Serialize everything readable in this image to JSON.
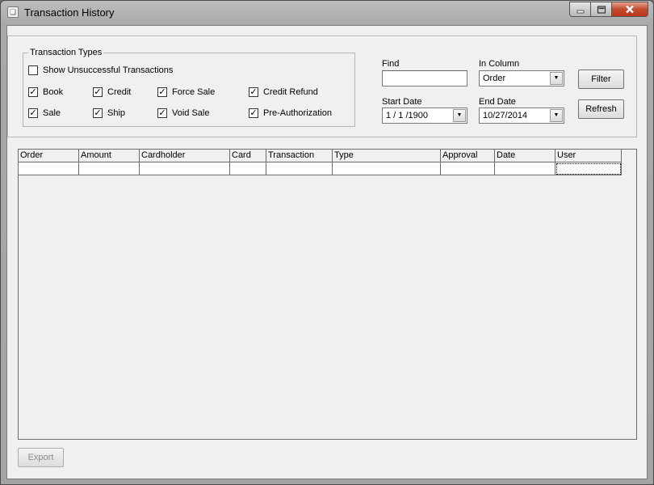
{
  "window": {
    "title": "Transaction History",
    "icon": "app-icon",
    "controls": {
      "minimize": "minimize-icon",
      "maximize": "maximize-icon",
      "close": "close-icon"
    }
  },
  "filters": {
    "group_title": "Transaction Types",
    "show_unsuccessful": {
      "label": "Show Unsuccessful Transactions",
      "checked": false
    },
    "types": [
      {
        "label": "Book",
        "checked": true
      },
      {
        "label": "Credit",
        "checked": true
      },
      {
        "label": "Force Sale",
        "checked": true
      },
      {
        "label": "Credit Refund",
        "checked": true
      },
      {
        "label": "Sale",
        "checked": true
      },
      {
        "label": "Ship",
        "checked": true
      },
      {
        "label": "Void Sale",
        "checked": true
      },
      {
        "label": "Pre-Authorization",
        "checked": true
      }
    ],
    "find": {
      "label": "Find",
      "value": ""
    },
    "in_column": {
      "label": "In Column",
      "value": "Order"
    },
    "start_date": {
      "label": "Start Date",
      "value": "1 / 1 /1900"
    },
    "end_date": {
      "label": "End Date",
      "value": "10/27/2014"
    },
    "filter_button": "Filter",
    "refresh_button": "Refresh"
  },
  "grid": {
    "columns": [
      "Order",
      "Amount",
      "Cardholder",
      "Card",
      "Transaction",
      "Type",
      "Approval",
      "Date",
      "User"
    ]
  },
  "footer": {
    "export_button": "Export"
  }
}
